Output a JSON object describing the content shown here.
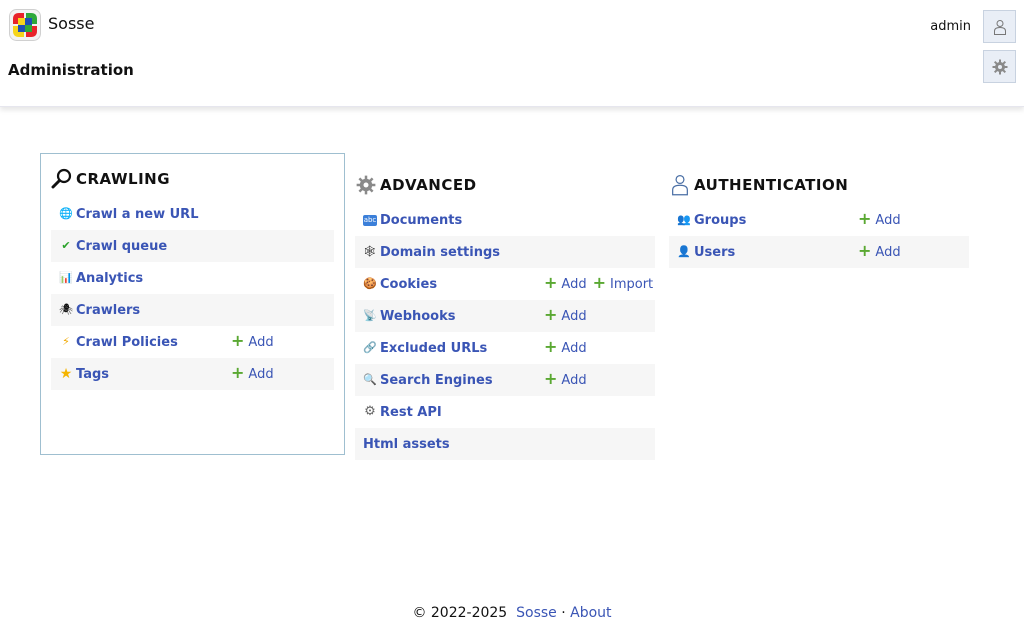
{
  "header": {
    "brand": "Sosse",
    "page_title": "Administration",
    "username": "admin",
    "user_button_icon": "user-outline-icon",
    "settings_button_icon": "gear-icon"
  },
  "crawling": {
    "title": "CRAWLING",
    "icon": "magnifier-icon",
    "items": [
      {
        "label": "Crawl a new URL",
        "icon": "globe-icon"
      },
      {
        "label": "Crawl queue",
        "icon": "checkmark-icon"
      },
      {
        "label": "Analytics",
        "icon": "bar-chart-icon"
      },
      {
        "label": "Crawlers",
        "icon": "bug-icon"
      },
      {
        "label": "Crawl Policies",
        "icon": "lightning-icon",
        "add": "Add"
      },
      {
        "label": "Tags",
        "icon": "star-icon",
        "add": "Add"
      }
    ]
  },
  "advanced": {
    "title": "ADVANCED",
    "icon": "gear-icon",
    "items": [
      {
        "label": "Documents",
        "icon": "abc-icon"
      },
      {
        "label": "Domain settings",
        "icon": "network-icon"
      },
      {
        "label": "Cookies",
        "icon": "cookie-icon",
        "add": "Add",
        "import": "Import"
      },
      {
        "label": "Webhooks",
        "icon": "satellite-icon",
        "add": "Add"
      },
      {
        "label": "Excluded URLs",
        "icon": "link-icon",
        "add": "Add"
      },
      {
        "label": "Search Engines",
        "icon": "search-icon",
        "add": "Add"
      },
      {
        "label": "Rest API",
        "icon": "gear-icon"
      },
      {
        "label": "Html assets"
      }
    ]
  },
  "authentication": {
    "title": "AUTHENTICATION",
    "icon": "user-outline-icon",
    "items": [
      {
        "label": "Groups",
        "icon": "group-icon",
        "add": "Add"
      },
      {
        "label": "Users",
        "icon": "user-icon",
        "add": "Add"
      }
    ]
  },
  "footer": {
    "copyright": "© 2022-2025",
    "brand_link": "Sosse",
    "separator": "·",
    "about_link": "About"
  },
  "colors": {
    "link": "#3a55b5",
    "add_plus": "#5aa832",
    "row_alt": "#f6f6f6",
    "panel_border": "#9fbfd0",
    "header_button_bg": "#e9eef6"
  }
}
